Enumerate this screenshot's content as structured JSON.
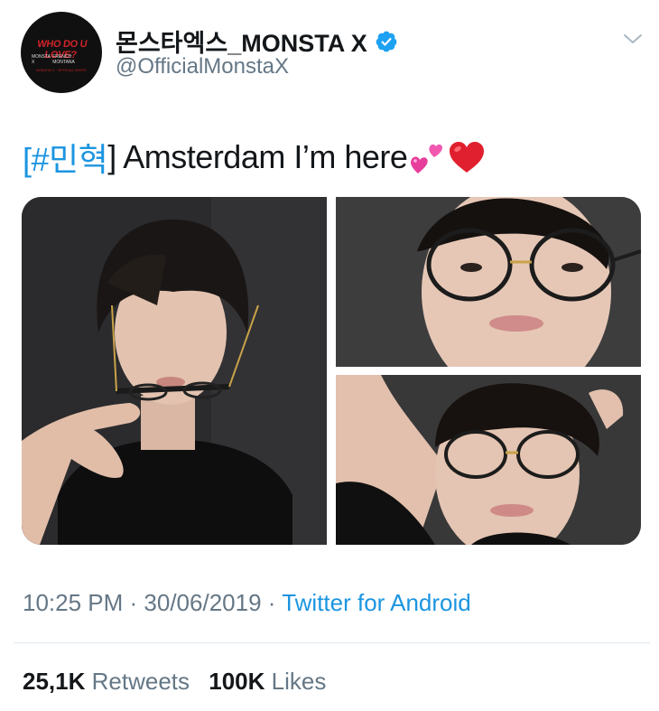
{
  "tweet": {
    "author": {
      "display_name": "몬스타엑스_MONSTA X",
      "handle": "@OfficialMonstaX",
      "avatar_text": {
        "line1": "WHO DO U LOVE?",
        "line2_left": "MONSTA X",
        "line2_right": "FRENCH MONTANA",
        "line3": "MONSTA X · OFFICIAL WHITE"
      }
    },
    "text": {
      "open_bracket": "[",
      "hashtag": "#민혁",
      "body": "] Amsterdam I’m here"
    },
    "emoji": [
      "two-hearts-emoji",
      "red-heart-emoji"
    ],
    "media": [
      {
        "name": "photo-selfie-glasses-in-mouth"
      },
      {
        "name": "photo-selfie-round-glasses"
      },
      {
        "name": "photo-selfie-arm-raised"
      }
    ],
    "meta": {
      "time": "10:25 PM",
      "separator": " · ",
      "date": "30/06/2019",
      "source": "Twitter for Android"
    },
    "stats": {
      "retweets_count": "25,1K",
      "retweets_label": "Retweets",
      "likes_count": "100K",
      "likes_label": "Likes"
    }
  },
  "colors": {
    "link": "#1b95e0",
    "secondary_text": "#657786",
    "primary_text": "#14171a",
    "verified": "#1da1f2",
    "divider": "#e1e8ed"
  },
  "icons": [
    "verified-badge-icon",
    "chevron-down-icon"
  ]
}
